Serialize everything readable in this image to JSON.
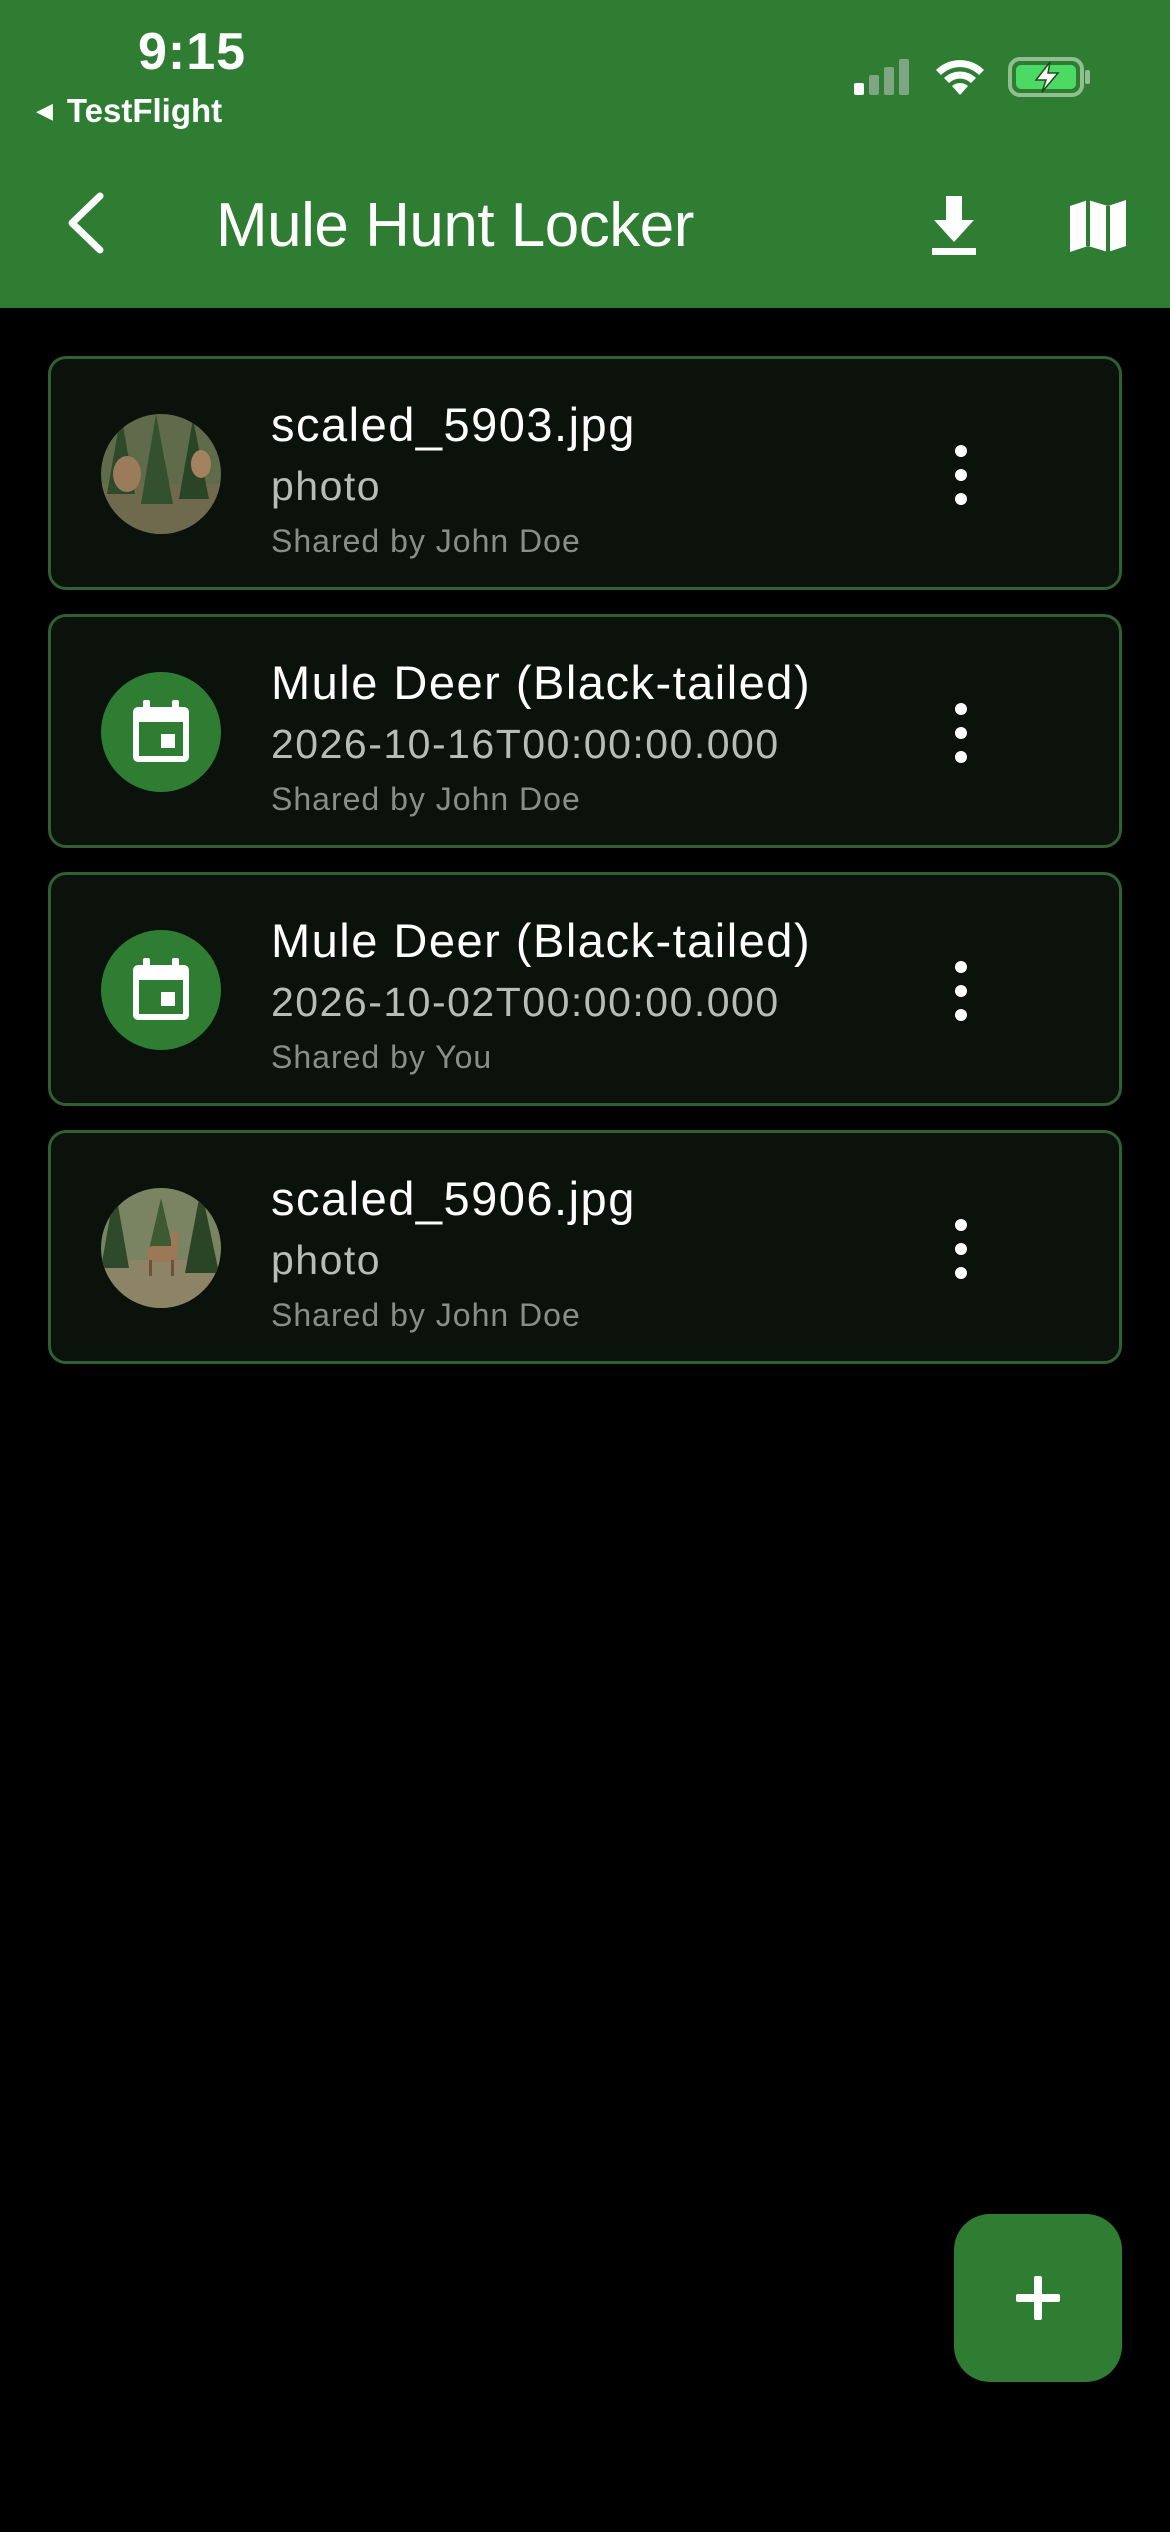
{
  "status_bar": {
    "time": "9:15",
    "back_app": "TestFlight",
    "icons": [
      "cellular-signal-icon",
      "wifi-icon",
      "battery-charging-icon"
    ]
  },
  "app_bar": {
    "title": "Mule Hunt Locker",
    "back_icon": "chevron-left-icon",
    "actions": [
      "download-icon",
      "map-icon"
    ]
  },
  "items": [
    {
      "kind": "photo",
      "title": "scaled_5903.jpg",
      "subtitle": "photo",
      "shared": "Shared by John Doe"
    },
    {
      "kind": "event",
      "title": "Mule Deer (Black-tailed)",
      "subtitle": "2026-10-16T00:00:00.000",
      "shared": "Shared by John Doe"
    },
    {
      "kind": "event",
      "title": "Mule Deer (Black-tailed)",
      "subtitle": "2026-10-02T00:00:00.000",
      "shared": "Shared by You"
    },
    {
      "kind": "photo",
      "title": "scaled_5906.jpg",
      "subtitle": "photo",
      "shared": "Shared by John Doe"
    }
  ],
  "fab": {
    "icon": "plus-icon"
  },
  "colors": {
    "primary": "#2e7d32",
    "card_background": "#0a120b",
    "card_border": "#2f5f33",
    "background": "#000000"
  }
}
